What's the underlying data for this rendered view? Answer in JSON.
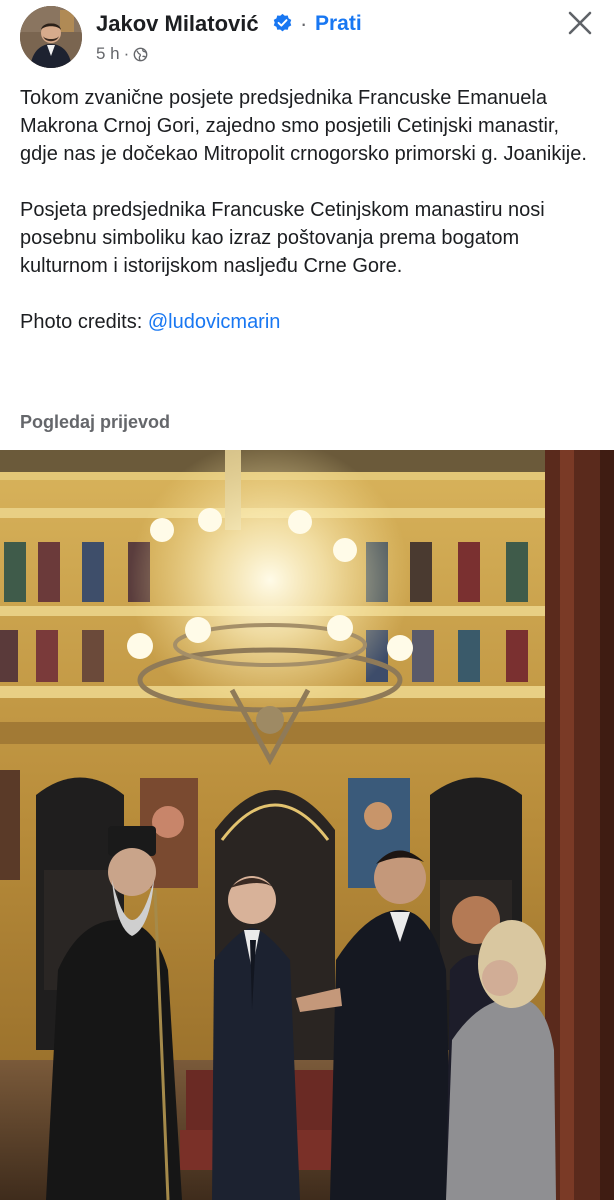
{
  "post": {
    "author": "Jakov Milatović",
    "verified": true,
    "follow_label": "Prati",
    "separator": "·",
    "time": "5 h",
    "meta_separator": "·",
    "audience_icon": "globe-icon",
    "close_icon": "close-icon",
    "paragraphs": [
      "Tokom zvanične posjete predsjednika Francuske Emanuela Makrona Crnoj Gori, zajedno smo posjetili Cetinjski manastir, gdje nas je dočekao Mitropolit crnogorsko primorski g. Joanikije.",
      "Posjeta predsjednika Francuske Cetinjskom manastiru nosi posebnu simboliku kao izraz poštovanja prema bogatom kulturnom i istorijskom nasljeđu Crne Gore."
    ],
    "credits_prefix": "Photo credits: ",
    "credits_mention": "@ludovicmarin",
    "translate_label": "Pogledaj prijevod"
  },
  "colors": {
    "link_blue": "#1877f2",
    "text_primary": "#1c1e21",
    "text_secondary": "#65676b",
    "iconostasis_gold": "#c9a24a",
    "wood_panel": "#5a2a1c"
  }
}
